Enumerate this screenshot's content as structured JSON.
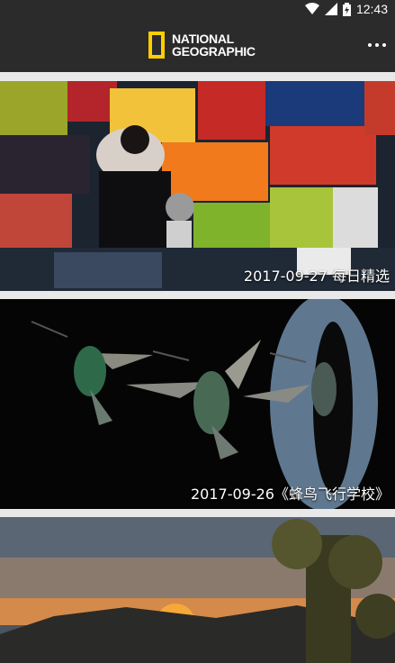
{
  "status_bar": {
    "time": "12:43",
    "icons": [
      "wifi-icon",
      "signal-icon",
      "battery-icon"
    ]
  },
  "toolbar": {
    "logo_line1": "NATIONAL",
    "logo_line2": "GEOGRAPHIC",
    "menu_icon": "more-vert-icon"
  },
  "cards": [
    {
      "caption": "2017-09-27 每日精选",
      "image": "fruit-market-photo"
    },
    {
      "caption": "2017-09-26《蜂鸟飞行学校》",
      "image": "hummingbirds-photo"
    },
    {
      "caption": "",
      "image": "desert-sunset-photo"
    }
  ],
  "colors": {
    "brand_yellow": "#ffce00",
    "toolbar": "#2b2b2b"
  }
}
